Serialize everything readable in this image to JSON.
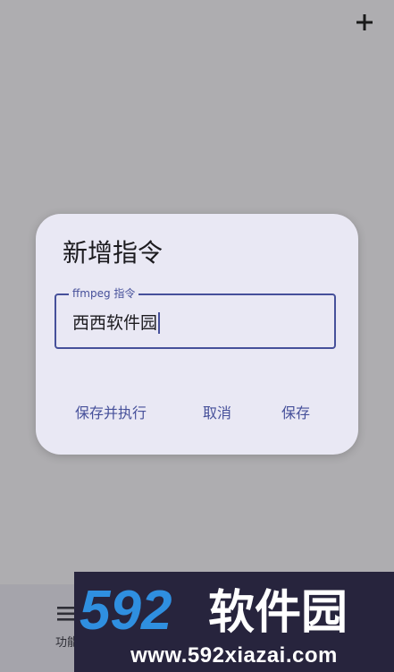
{
  "toolbar": {
    "add_icon": "plus-icon"
  },
  "dialog": {
    "title": "新增指令",
    "field": {
      "label": "ffmpeg 指令",
      "value": "西西软件园"
    },
    "actions": {
      "save_and_run": "保存并执行",
      "cancel": "取消",
      "save": "保存"
    }
  },
  "bottom_nav": {
    "items": [
      {
        "label": "功能",
        "icon": "menu-lines-icon"
      }
    ]
  },
  "watermark": {
    "logo_text": "592软件园",
    "url": "www.592xiazai.com"
  },
  "colors": {
    "scrim": "#aeadb0",
    "dialog_bg": "#e9e8f4",
    "accent": "#46509a",
    "watermark_bg": "#27243d",
    "watermark_number": "#2f8fe0"
  }
}
